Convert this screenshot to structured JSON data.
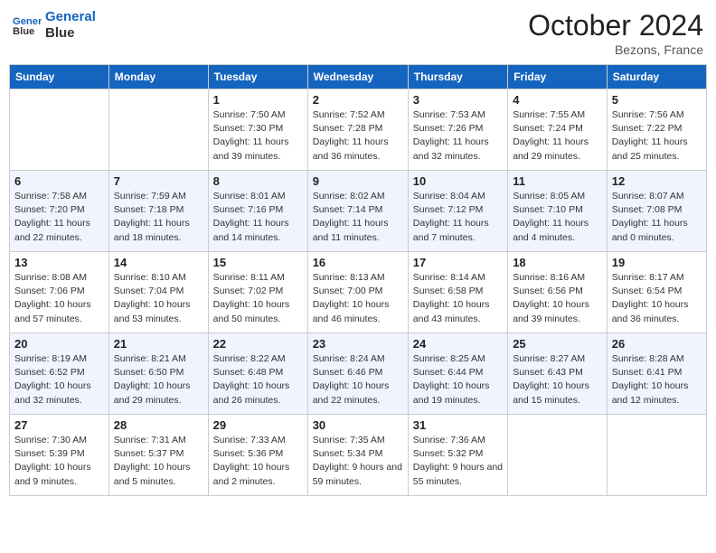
{
  "header": {
    "logo_line1": "General",
    "logo_line2": "Blue",
    "month": "October 2024",
    "location": "Bezons, France"
  },
  "weekdays": [
    "Sunday",
    "Monday",
    "Tuesday",
    "Wednesday",
    "Thursday",
    "Friday",
    "Saturday"
  ],
  "weeks": [
    [
      {
        "day": "",
        "info": ""
      },
      {
        "day": "",
        "info": ""
      },
      {
        "day": "1",
        "info": "Sunrise: 7:50 AM\nSunset: 7:30 PM\nDaylight: 11 hours and 39 minutes."
      },
      {
        "day": "2",
        "info": "Sunrise: 7:52 AM\nSunset: 7:28 PM\nDaylight: 11 hours and 36 minutes."
      },
      {
        "day": "3",
        "info": "Sunrise: 7:53 AM\nSunset: 7:26 PM\nDaylight: 11 hours and 32 minutes."
      },
      {
        "day": "4",
        "info": "Sunrise: 7:55 AM\nSunset: 7:24 PM\nDaylight: 11 hours and 29 minutes."
      },
      {
        "day": "5",
        "info": "Sunrise: 7:56 AM\nSunset: 7:22 PM\nDaylight: 11 hours and 25 minutes."
      }
    ],
    [
      {
        "day": "6",
        "info": "Sunrise: 7:58 AM\nSunset: 7:20 PM\nDaylight: 11 hours and 22 minutes."
      },
      {
        "day": "7",
        "info": "Sunrise: 7:59 AM\nSunset: 7:18 PM\nDaylight: 11 hours and 18 minutes."
      },
      {
        "day": "8",
        "info": "Sunrise: 8:01 AM\nSunset: 7:16 PM\nDaylight: 11 hours and 14 minutes."
      },
      {
        "day": "9",
        "info": "Sunrise: 8:02 AM\nSunset: 7:14 PM\nDaylight: 11 hours and 11 minutes."
      },
      {
        "day": "10",
        "info": "Sunrise: 8:04 AM\nSunset: 7:12 PM\nDaylight: 11 hours and 7 minutes."
      },
      {
        "day": "11",
        "info": "Sunrise: 8:05 AM\nSunset: 7:10 PM\nDaylight: 11 hours and 4 minutes."
      },
      {
        "day": "12",
        "info": "Sunrise: 8:07 AM\nSunset: 7:08 PM\nDaylight: 11 hours and 0 minutes."
      }
    ],
    [
      {
        "day": "13",
        "info": "Sunrise: 8:08 AM\nSunset: 7:06 PM\nDaylight: 10 hours and 57 minutes."
      },
      {
        "day": "14",
        "info": "Sunrise: 8:10 AM\nSunset: 7:04 PM\nDaylight: 10 hours and 53 minutes."
      },
      {
        "day": "15",
        "info": "Sunrise: 8:11 AM\nSunset: 7:02 PM\nDaylight: 10 hours and 50 minutes."
      },
      {
        "day": "16",
        "info": "Sunrise: 8:13 AM\nSunset: 7:00 PM\nDaylight: 10 hours and 46 minutes."
      },
      {
        "day": "17",
        "info": "Sunrise: 8:14 AM\nSunset: 6:58 PM\nDaylight: 10 hours and 43 minutes."
      },
      {
        "day": "18",
        "info": "Sunrise: 8:16 AM\nSunset: 6:56 PM\nDaylight: 10 hours and 39 minutes."
      },
      {
        "day": "19",
        "info": "Sunrise: 8:17 AM\nSunset: 6:54 PM\nDaylight: 10 hours and 36 minutes."
      }
    ],
    [
      {
        "day": "20",
        "info": "Sunrise: 8:19 AM\nSunset: 6:52 PM\nDaylight: 10 hours and 32 minutes."
      },
      {
        "day": "21",
        "info": "Sunrise: 8:21 AM\nSunset: 6:50 PM\nDaylight: 10 hours and 29 minutes."
      },
      {
        "day": "22",
        "info": "Sunrise: 8:22 AM\nSunset: 6:48 PM\nDaylight: 10 hours and 26 minutes."
      },
      {
        "day": "23",
        "info": "Sunrise: 8:24 AM\nSunset: 6:46 PM\nDaylight: 10 hours and 22 minutes."
      },
      {
        "day": "24",
        "info": "Sunrise: 8:25 AM\nSunset: 6:44 PM\nDaylight: 10 hours and 19 minutes."
      },
      {
        "day": "25",
        "info": "Sunrise: 8:27 AM\nSunset: 6:43 PM\nDaylight: 10 hours and 15 minutes."
      },
      {
        "day": "26",
        "info": "Sunrise: 8:28 AM\nSunset: 6:41 PM\nDaylight: 10 hours and 12 minutes."
      }
    ],
    [
      {
        "day": "27",
        "info": "Sunrise: 7:30 AM\nSunset: 5:39 PM\nDaylight: 10 hours and 9 minutes."
      },
      {
        "day": "28",
        "info": "Sunrise: 7:31 AM\nSunset: 5:37 PM\nDaylight: 10 hours and 5 minutes."
      },
      {
        "day": "29",
        "info": "Sunrise: 7:33 AM\nSunset: 5:36 PM\nDaylight: 10 hours and 2 minutes."
      },
      {
        "day": "30",
        "info": "Sunrise: 7:35 AM\nSunset: 5:34 PM\nDaylight: 9 hours and 59 minutes."
      },
      {
        "day": "31",
        "info": "Sunrise: 7:36 AM\nSunset: 5:32 PM\nDaylight: 9 hours and 55 minutes."
      },
      {
        "day": "",
        "info": ""
      },
      {
        "day": "",
        "info": ""
      }
    ]
  ]
}
